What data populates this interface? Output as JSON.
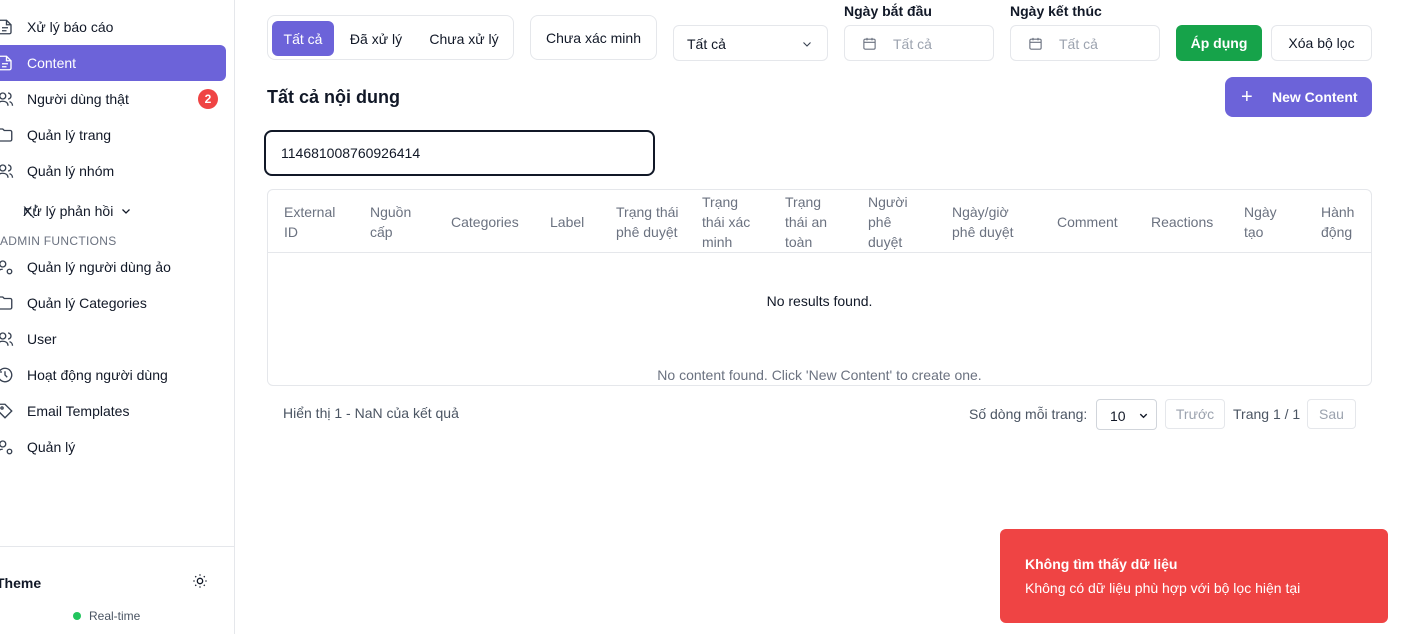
{
  "sidebar": {
    "items": [
      {
        "label": "Xử lý báo cáo",
        "icon": "report-icon"
      },
      {
        "label": "Content",
        "icon": "document-icon",
        "active": true
      },
      {
        "label": "Người dùng thật",
        "icon": "users-icon",
        "badge": "2"
      },
      {
        "label": "Quản lý trang",
        "icon": "folder-icon"
      },
      {
        "label": "Quản lý nhóm",
        "icon": "users-icon"
      },
      {
        "label": "Xử lý phản hồi",
        "icon": "reply-icon"
      },
      {
        "label": "Quản lý người dùng ảo",
        "icon": "user-cog-icon"
      },
      {
        "label": "Quản lý Categories",
        "icon": "folder-icon"
      },
      {
        "label": "User",
        "icon": "users-icon"
      },
      {
        "label": "Hoạt động người dùng",
        "icon": "history-icon"
      },
      {
        "label": "Email Templates",
        "icon": "tag-icon"
      },
      {
        "label": "Quản lý",
        "icon": "user-cog-icon"
      }
    ],
    "section_label": "ADMIN FUNCTIONS",
    "theme_label": "Theme",
    "realtime_label": "Real-time"
  },
  "filters": {
    "tabs": [
      "Tất cả",
      "Đã xử lý",
      "Chưa xử lý"
    ],
    "active_tab": "Tất cả",
    "unverified_label": "Chưa xác minh",
    "select_value": "Tất cả",
    "start_date_label": "Ngày bắt đầu",
    "start_date_placeholder": "Tất cả",
    "end_date_label": "Ngày kết thúc",
    "end_date_placeholder": "Tất cả",
    "apply_label": "Áp dụng",
    "clear_label": "Xóa bộ lọc"
  },
  "main": {
    "title": "Tất cả nội dung",
    "new_content_label": "New Content",
    "search_value": "114681008760926414"
  },
  "table": {
    "columns": [
      "External ID",
      "Nguồn cấp",
      "Categories",
      "Label",
      "Trạng thái phê duyệt",
      "Trạng thái xác minh",
      "Trạng thái an toàn",
      "Người phê duyệt",
      "Ngày/giờ phê duyệt",
      "Comment",
      "Reactions",
      "Ngày tạo",
      "Hành động"
    ],
    "empty_text": "No results found.",
    "caption": "No content found. Click 'New Content' to create one."
  },
  "pagination": {
    "summary": "Hiển thị 1 - NaN của kết quả",
    "rows_label": "Số dòng mỗi trang:",
    "rows_value": "10",
    "prev_label": "Trước",
    "page_label": "Trang 1 / 1",
    "next_label": "Sau"
  },
  "toast": {
    "title": "Không tìm thấy dữ liệu",
    "description": "Không có dữ liệu phù hợp với bộ lọc hiện tại",
    "color": "#ef4444"
  },
  "colors": {
    "accent": "#6c63d9",
    "apply": "#16a34a",
    "badge": "#ef4444",
    "online": "#22c55e"
  }
}
